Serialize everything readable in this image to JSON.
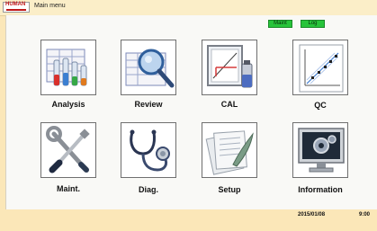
{
  "titlebar": {
    "logo_text": "HUMAN",
    "title": "Main menu"
  },
  "top_buttons": {
    "maint_label": "Maint",
    "log_label": "Log"
  },
  "menu": {
    "analysis": "Analysis",
    "review": "Review",
    "cal": "CAL",
    "qc": "QC",
    "maint": "Maint.",
    "diag": "Diag.",
    "setup": "Setup",
    "information": "Information"
  },
  "status": {
    "date": "2015/01/08",
    "time": "9:00"
  },
  "colors": {
    "background": "#fbe7b8",
    "panel": "#f9f9f6",
    "status_button": "#27c43a"
  }
}
